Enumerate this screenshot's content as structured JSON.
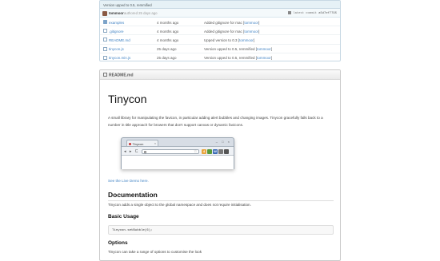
{
  "commit": {
    "message": "Version upped to 0.5, remmified",
    "author": "tommoor",
    "authored": "authored 25 days ago",
    "latest_label": "latest commit",
    "sha": "a5d7ef7795"
  },
  "files": [
    {
      "icon": "folder-icon",
      "name": "examples",
      "age": "4 months ago",
      "message": "Added gitignore for mac",
      "author": "tommoor"
    },
    {
      "icon": "file-icon",
      "name": ".gitignore",
      "age": "4 months ago",
      "message": "Added gitignore for mac",
      "author": "tommoor"
    },
    {
      "icon": "file-icon",
      "name": "README.md",
      "age": "4 months ago",
      "message": "Upped version to 0.3",
      "author": "tommoor"
    },
    {
      "icon": "file-icon",
      "name": "tinycon.js",
      "age": "25 days ago",
      "message": "Version upped to 0.5, remmified",
      "author": "tommoor"
    },
    {
      "icon": "file-icon",
      "name": "tinycon.min.js",
      "age": "25 days ago",
      "message": "Version upped to 0.5, remmified",
      "author": "tommoor"
    }
  ],
  "readme": {
    "filename": "README.md",
    "title": "Tinycon",
    "intro": "A small library for manipulating the favicon, in particular adding alert bubbles and changing images. Tinycon gracefully falls back to a number in title approach for browers that don't support canvas or dynamic favicons.",
    "demo_link": "See the Live Demo here.",
    "documentation_heading": "Documentation",
    "documentation_text": "Tinycon adds a single object to the global namespace and does not require initialisation.",
    "basic_usage_heading": "Basic Usage",
    "code": "Tinycon.setBubble(6);",
    "options_heading": "Options",
    "options_text": "Tinycon can take a range of options to customise the look"
  },
  "mini_browser": {
    "tab_title": "Tinycon",
    "tab_close": "×",
    "window_buttons": "– □ ×",
    "nav_glyphs": "◂ ▸ C ⌂",
    "star": "☆",
    "ext_labels": [
      "4",
      "W"
    ]
  },
  "colors": {
    "link": "#4183c4",
    "commit_bar": "#e6f1f6"
  }
}
